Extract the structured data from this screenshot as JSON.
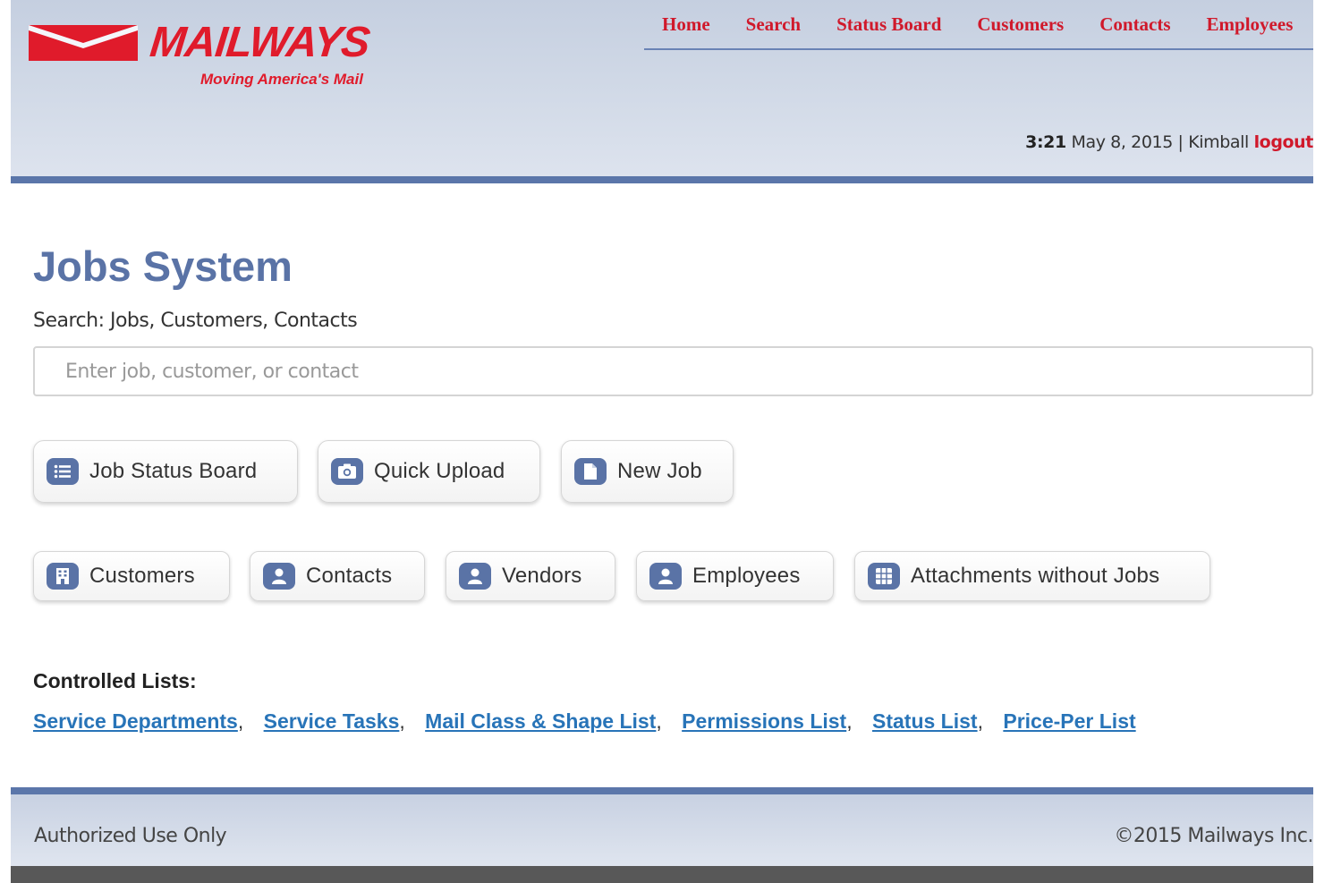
{
  "brand": {
    "name": "MAILWAYS",
    "tagline": "Moving America's Mail",
    "color": "#e01b2b"
  },
  "nav": {
    "items": [
      {
        "label": "Home"
      },
      {
        "label": "Search"
      },
      {
        "label": "Status Board"
      },
      {
        "label": "Customers"
      },
      {
        "label": "Contacts"
      },
      {
        "label": "Employees"
      }
    ]
  },
  "status": {
    "time": "3:21",
    "date": "May 8, 2015",
    "separator": "|",
    "user": "Kimball",
    "logout_label": "logout"
  },
  "main": {
    "title": "Jobs System",
    "search_label": "Search: Jobs, Customers, Contacts",
    "search_placeholder": "Enter job, customer, or contact",
    "primary_buttons": [
      {
        "label": "Job Status Board",
        "icon": "list-icon"
      },
      {
        "label": "Quick Upload",
        "icon": "camera-icon"
      },
      {
        "label": "New Job",
        "icon": "document-icon"
      }
    ],
    "secondary_buttons": [
      {
        "label": "Customers",
        "icon": "building-icon"
      },
      {
        "label": "Contacts",
        "icon": "user-icon"
      },
      {
        "label": "Vendors",
        "icon": "user-icon"
      },
      {
        "label": "Employees",
        "icon": "user-icon"
      },
      {
        "label": "Attachments without Jobs",
        "icon": "grid-icon"
      }
    ],
    "controlled_lists_label": "Controlled Lists:",
    "controlled_lists": [
      {
        "label": "Service Departments"
      },
      {
        "label": "Service Tasks"
      },
      {
        "label": "Mail Class & Shape List"
      },
      {
        "label": "Permissions List"
      },
      {
        "label": "Status List"
      },
      {
        "label": "Price-Per List"
      }
    ],
    "list_separator": ","
  },
  "footer": {
    "left": "Authorized Use Only",
    "right": "©2015 Mailways Inc."
  },
  "colors": {
    "accent": "#5a73a6",
    "nav_link": "#d0192b",
    "link": "#2874b8"
  }
}
